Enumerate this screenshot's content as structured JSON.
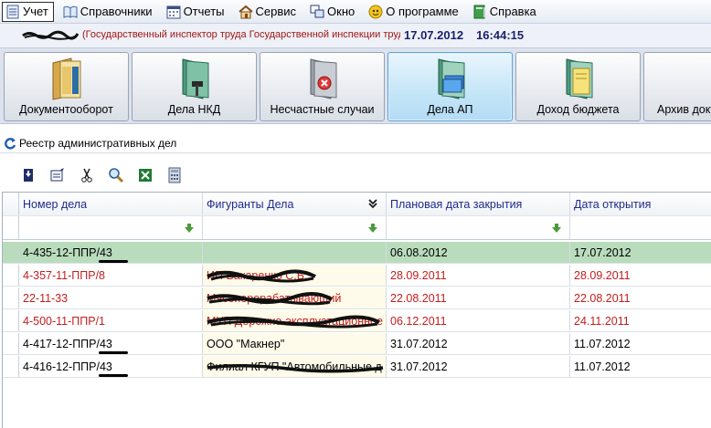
{
  "menu": {
    "items": [
      {
        "label": "Учет",
        "icon": "ledger-icon",
        "active": true
      },
      {
        "label": "Справочники",
        "icon": "book-icon"
      },
      {
        "label": "Отчеты",
        "icon": "calendar-icon"
      },
      {
        "label": "Сервис",
        "icon": "home-icon"
      },
      {
        "label": "Окно",
        "icon": "windows-icon"
      },
      {
        "label": "О программе",
        "icon": "info-icon"
      },
      {
        "label": "Справка",
        "icon": "help-book-icon"
      }
    ]
  },
  "status": {
    "user_info": "(Государственный инспектор труда Государственной инспекции труда",
    "date": "17.07.2012",
    "time": "16:44:15"
  },
  "big_buttons": [
    {
      "label": "Документооборот",
      "icon": "binder-folder-icon"
    },
    {
      "label": "Дела НКД",
      "icon": "folder-hammer-icon"
    },
    {
      "label": "Несчастные случаи",
      "icon": "folder-warning-icon"
    },
    {
      "label": "Дела АП",
      "icon": "folder-documents-icon",
      "active": true
    },
    {
      "label": "Доход бюджета",
      "icon": "folder-coins-icon"
    },
    {
      "label": "Архив документов",
      "icon": "archive-binder-icon"
    }
  ],
  "registry": {
    "title": "Реестр административных дел",
    "toolbar": [
      "download-icon",
      "edit-icon",
      "cut-icon",
      "search-icon",
      "excel-icon",
      "calculator-icon"
    ],
    "columns": [
      "Номер дела",
      "Фигуранты Дела",
      "Плановая дата закрытия",
      "Дата открытия"
    ],
    "rows": [
      {
        "number": "4-435-12-ППР/43",
        "figurant": "",
        "planned_close": "06.08.2012",
        "opened": "17.07.2012",
        "style": "selected"
      },
      {
        "number": "4-357-11-ППР/8",
        "figurant": "ИП Вакаренко С.Б.",
        "planned_close": "28.09.2011",
        "opened": "28.09.2011",
        "style": "red"
      },
      {
        "number": "22-11-33",
        "figurant": "Мясоперерабатывающий",
        "planned_close": "22.08.2011",
        "opened": "22.08.2011",
        "style": "red"
      },
      {
        "number": "4-500-11-ППР/1",
        "figurant": "МУП Дорожно-эксплуатационное бю",
        "planned_close": "06.12.2011",
        "opened": "24.11.2011",
        "style": "red"
      },
      {
        "number": "4-417-12-ППР/43",
        "figurant": "ООО \"Макнер\"",
        "planned_close": "31.07.2012",
        "opened": "11.07.2012",
        "style": "normal"
      },
      {
        "number": "4-416-12-ППР/43",
        "figurant": "Филиал КГУП \"Автомобильные д",
        "planned_close": "31.07.2012",
        "opened": "11.07.2012",
        "style": "normal"
      }
    ]
  }
}
